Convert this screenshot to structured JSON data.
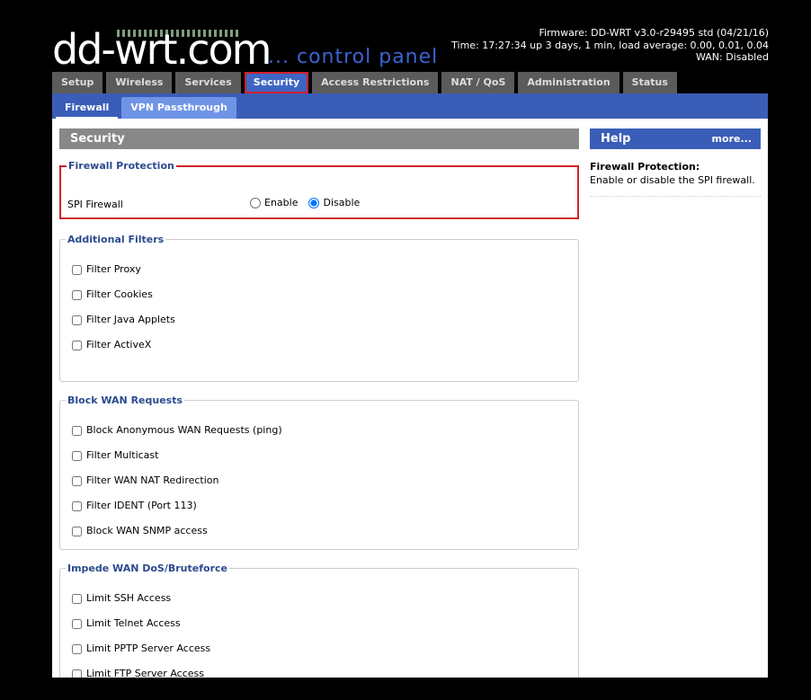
{
  "logo": {
    "main": "dd-wrt.com",
    "sub": "... control panel"
  },
  "firmware": {
    "line1": "Firmware: DD-WRT v3.0-r29495 std (04/21/16)",
    "line2": "Time: 17:27:34 up 3 days, 1 min, load average: 0.00, 0.01, 0.04",
    "line3": "WAN: Disabled"
  },
  "main_tabs": [
    "Setup",
    "Wireless",
    "Services",
    "Security",
    "Access Restrictions",
    "NAT / QoS",
    "Administration",
    "Status"
  ],
  "sub_tabs": [
    "Firewall",
    "VPN Passthrough"
  ],
  "section_title": "Security",
  "firewall": {
    "legend": "Firewall Protection",
    "label": "SPI Firewall",
    "enable": "Enable",
    "disable": "Disable"
  },
  "additional": {
    "legend": "Additional Filters",
    "items": [
      "Filter Proxy",
      "Filter Cookies",
      "Filter Java Applets",
      "Filter ActiveX"
    ]
  },
  "block": {
    "legend": "Block WAN Requests",
    "items": [
      "Block Anonymous WAN Requests (ping)",
      "Filter Multicast",
      "Filter WAN NAT Redirection",
      "Filter IDENT (Port 113)",
      "Block WAN SNMP access"
    ]
  },
  "impede": {
    "legend": "Impede WAN DoS/Bruteforce",
    "items": [
      "Limit SSH Access",
      "Limit Telnet Access",
      "Limit PPTP Server Access",
      "Limit FTP Server Access"
    ]
  },
  "help": {
    "title": "Help",
    "more": "more...",
    "topic": "Firewall Protection:",
    "text": "Enable or disable the SPI firewall."
  },
  "colors": {
    "accent": "#3a5db8",
    "highlight": "#d0202a",
    "legend": "#2b4a8f"
  }
}
